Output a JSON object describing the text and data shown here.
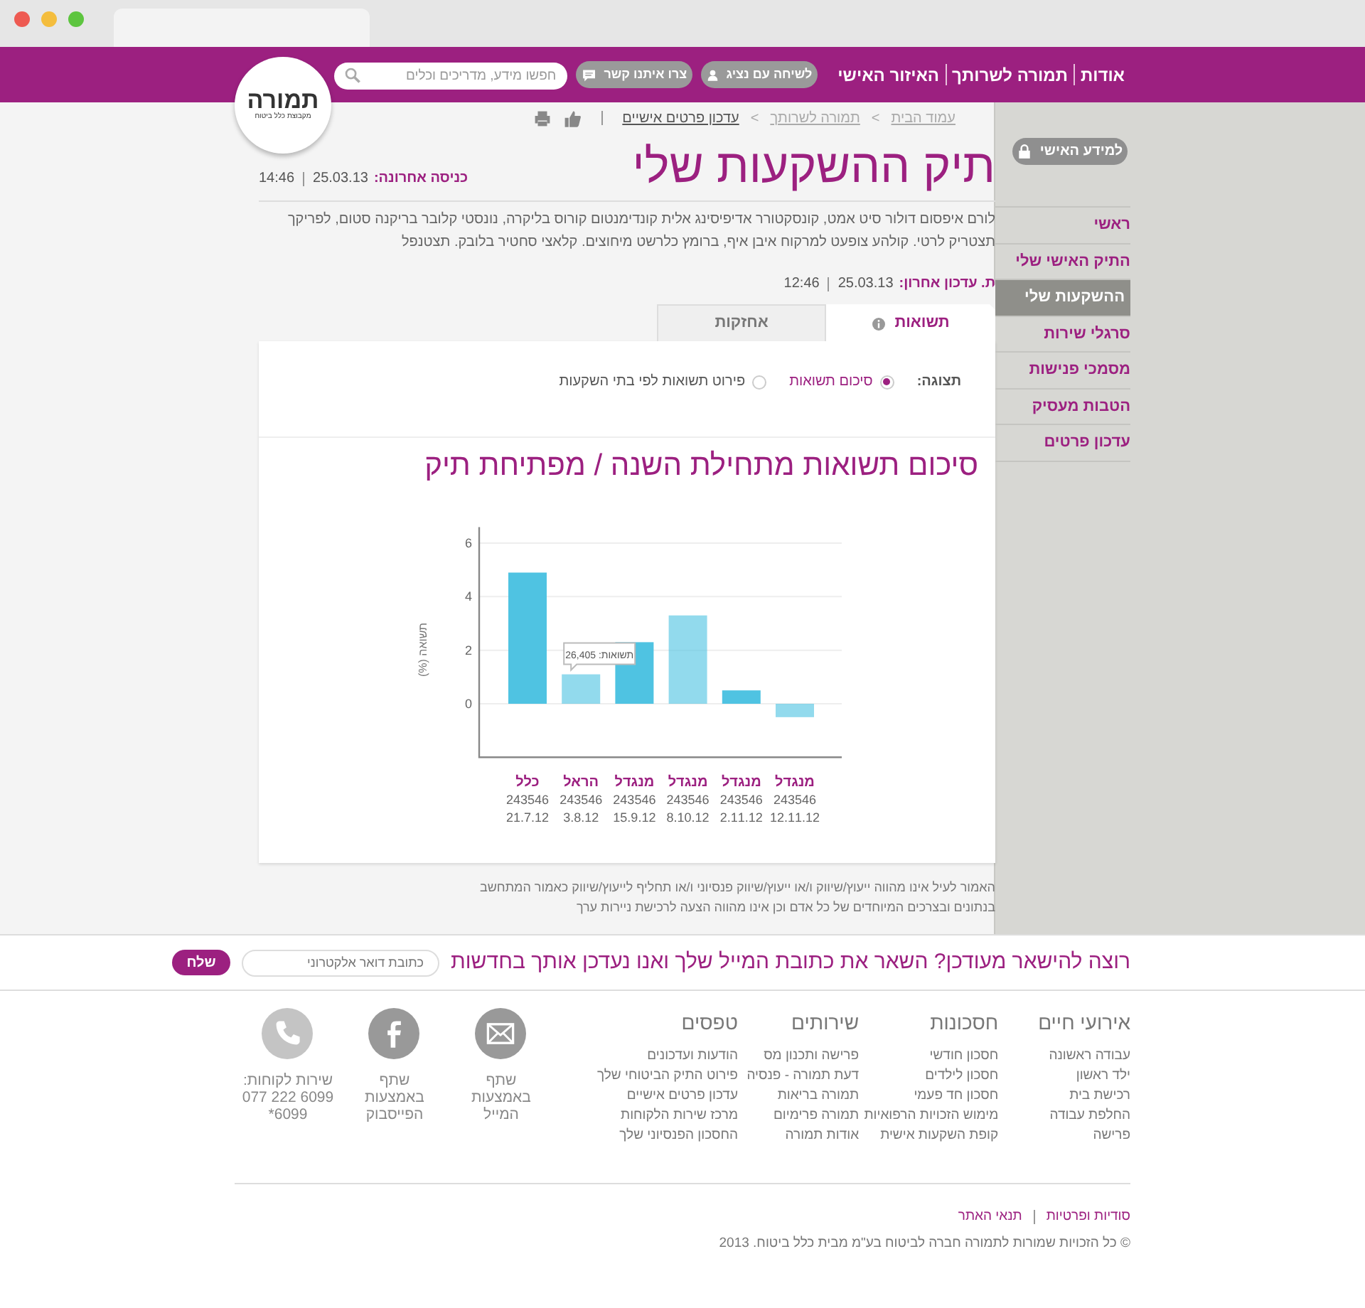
{
  "header": {
    "nav": [
      "אודות",
      "תמורה לשרותך",
      "האיזור האישי"
    ],
    "buttons": [
      {
        "label": "לשיחה עם נציג",
        "kind": "person"
      },
      {
        "label": "צרו איתנו קשר",
        "kind": "chat"
      }
    ],
    "search": {
      "placeholder": "חפשו מידע, מדריכים וכלים"
    },
    "logo": {
      "text": "תמורה",
      "tagline": "מקבוצת כלל ביטוח"
    }
  },
  "breadcrumbs": [
    {
      "label": "עמוד הבית",
      "current": false
    },
    {
      "label": "תמורה לשרותך",
      "current": false
    },
    {
      "label": "עדכון פרטים אישיים",
      "current": true
    }
  ],
  "breadcrumb_separators": [
    ">",
    ">"
  ],
  "title": "תיק ההשקעות שלי",
  "last_login": {
    "label": "כניסה אחרונה:",
    "date": "25.03.13",
    "time": "14:46"
  },
  "description": "לורם איפסום דולור סיט אמט, קונסקטורר אדיפיסינג אלית קונדימנטום קורוס בליקרה, נונסטי קלובר בריקנה סטום, לפריקך תצטריק לרטי. קולהע צופעט למרקוח איבן איף, ברומץ כלרשט מיחוצים. קלאצי סחטיר בלובק. תצטנפל",
  "last_update": {
    "label": "ת. עדכון אחרון:",
    "date": "25.03.13",
    "time": "12:46"
  },
  "tabs": [
    {
      "label": "תשואות",
      "selected": true,
      "info": true
    },
    {
      "label": "אחזקות",
      "selected": false,
      "info": false
    }
  ],
  "view": {
    "label": "תצוגה:",
    "options": [
      {
        "label": "סיכום תשואות",
        "selected": true
      },
      {
        "label": "פירוט תשואות לפי בתי השקעות",
        "selected": false
      }
    ]
  },
  "chart": {
    "chart_data": {
      "type": "bar",
      "title": "סיכום תשואות מתחילת השנה / מפתיחת  תיק",
      "ylabel": "תשואה (%)",
      "categories": [
        "כלל\n243546\n21.7.12",
        "הראל\n243546\n3.8.12",
        "מנגדל\n243546\n15.9.12",
        "מנגדל\n243546\n8.10.12",
        "מנגדל\n243546\n2.11.12",
        "מנגדל\n243546\n12.11.12"
      ],
      "series": [
        {
          "color": "#4fc3e2",
          "values": [
            4.9,
            1.1,
            2.3,
            3.3,
            0.5,
            -0.5
          ]
        }
      ],
      "ylim": [
        -2,
        6.6
      ],
      "yticks": [
        0,
        2,
        4,
        6
      ],
      "grid": true,
      "annotations": [
        "תשואות: 26,405"
      ]
    }
  },
  "disclaimer": "האמור לעיל אינו מהווה ייעוץ/שיווק ו/או ייעוץ/שיווק פנסיוני ו/או תחליף לייעוץ/שיווק כאמור המתחשב בנתונים ובצרכים המיוחדים של כל אדם וכן אינו מהווה הצעה לרכישת ניירות ערך",
  "sidebar": {
    "personal_button": "למידע האישי",
    "items": [
      {
        "label": "ראשי",
        "selected": false
      },
      {
        "label": "התיק האישי שלי",
        "selected": false
      },
      {
        "label": "ההשקעות שלי",
        "selected": true
      },
      {
        "label": "סרגלי שירות",
        "selected": false
      },
      {
        "label": "מסמכי פנישות",
        "selected": false
      },
      {
        "label": "הטבות מעסיק",
        "selected": false
      },
      {
        "label": "עדכון פרטים",
        "selected": false
      }
    ]
  },
  "newsletter": {
    "text": "רוצה להישאר מעודכן? השאר את כתובת המייל שלך ואנו נעדכן אותך בחדשות",
    "placeholder": "כתובת דואר אלקטרוני",
    "button": "שלח"
  },
  "footer": {
    "columns": [
      {
        "heading": "אירועי חיים",
        "links": [
          "עבודה ראשונה",
          "ילד ראשון",
          "רכישת בית",
          "החלפת עבודה",
          "פרישה"
        ]
      },
      {
        "heading": "חסכונות",
        "links": [
          "חסכון חודשי",
          "חסכון לילדים",
          "חסכון חד פעמי",
          "מימוש הזכויות הרפואיות",
          "קופת השקעות אישית"
        ]
      },
      {
        "heading": "שירותים",
        "links": [
          "פרישה ותכנון מס",
          "דעת תמורה - פנסיה",
          "תמורה בריאות",
          "תמורה פרימיום",
          "אודות תמורה"
        ]
      },
      {
        "heading": "טפסים",
        "links": [
          "הודעות ועדכונים",
          "פירוט התיק הביטוחי שלך",
          "עדכון פרטים אישיים",
          "מרכז שירות הלקוחות",
          "החסכון הפנסיוני שלך"
        ]
      }
    ],
    "contacts": [
      {
        "kind": "mail",
        "lines": [
          "שתף",
          "באמצעות",
          "המייל"
        ]
      },
      {
        "kind": "facebook",
        "lines": [
          "שתף",
          "באמצעות",
          "הפייסבוק"
        ]
      },
      {
        "kind": "phone",
        "lines": [
          "שירות לקוחות:",
          "077 222 6099",
          "*6099"
        ]
      }
    ],
    "legal_links": [
      "סודיות ופרטיות",
      "תנאי האתר"
    ],
    "copyright": "© כל הזכויות שמורות לתמורה חברה לביטוח בע\"מ מבית כלל ביטוח. 2013"
  }
}
